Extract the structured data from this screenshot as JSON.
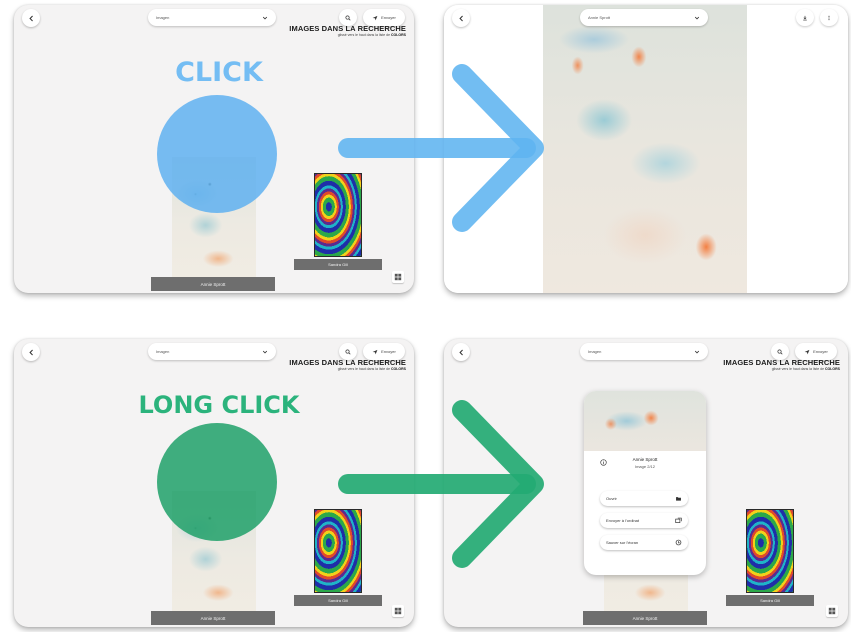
{
  "colors": {
    "click_accent": "#74bdf3",
    "long_click_accent": "#2bb37c",
    "label_bar": "#6e6e6e",
    "panel_bg": "#f4f3f3"
  },
  "icons": {
    "back": "chevron-left-icon",
    "dropdown": "chevron-down-icon",
    "search": "search-icon",
    "share": "share-icon",
    "grid": "grid-icon"
  },
  "header": {
    "search_value": "Imagen",
    "share_label": "Envoyer",
    "title": "IMAGES DANS LA RECHERCHE",
    "subtitle_prefix": "glissé vers le haut dans la liste de",
    "subtitle_brand": "COLORS"
  },
  "gallery": {
    "tall_art_caption": "Annie Sprott",
    "swirl_art_caption": "Sandra Gill"
  },
  "viewer": {
    "search_value": "Annie Sprott"
  },
  "steps": {
    "click_label": "CLICK",
    "long_click_label": "LONG CLICK"
  },
  "context_sheet": {
    "title": "Annie Sprott",
    "subtitle": "Image 2/12",
    "actions": [
      {
        "label": "Ouvrir",
        "icon": "open-icon"
      },
      {
        "label": "Envoyer à l'ordinat",
        "icon": "send-icon"
      },
      {
        "label": "Sauver sur l'écran",
        "icon": "save-icon"
      }
    ]
  }
}
